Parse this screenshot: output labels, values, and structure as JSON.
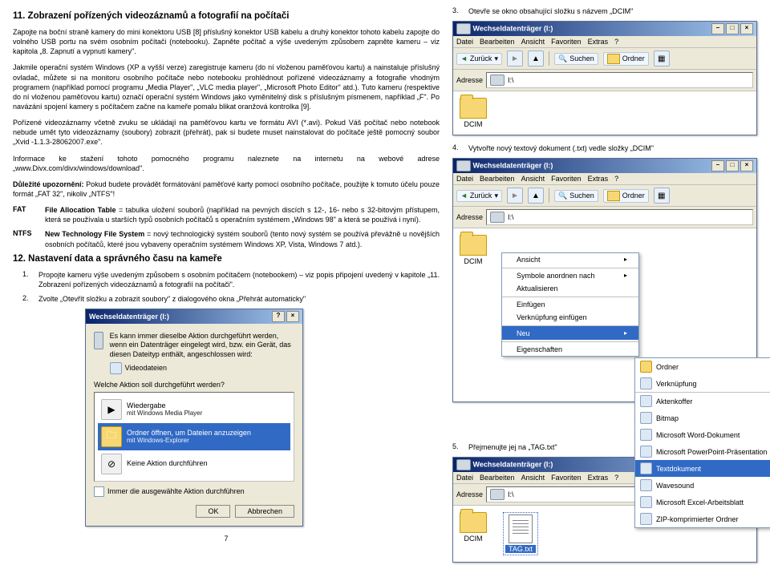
{
  "section11": {
    "title": "11. Zobrazení pořízených videozáznamů a fotografií na počítači",
    "p1": "Zapojte na boční straně kamery do mini konektoru USB [8] příslušný konektor USB kabelu a druhý konektor tohoto kabelu zapojte do volného USB portu na svém osobním počítači (notebooku). Zapněte počítač a výše uvedeným způsobem zapněte kameru – viz kapitola „8. Zapnutí a vypnutí kamery\".",
    "p2": "Jakmile operační systém Windows (XP a vyšší verze) zaregistruje kameru (do ní vloženou paměťovou kartu) a nainstaluje příslušný ovladač, můžete si na monitoru osobního počítače nebo notebooku prohlédnout pořízené videozáznamy a fotografie vhodným programem (například pomocí programu „Media Player\", „VLC media player\", „Microsoft Photo Editor\" atd.). Tuto kameru (respektive do ní vloženou paměťovou kartu) označí operační systém Windows jako vyměnitelný disk s příslušným písmenem, například „F\". Po navázání spojení kamery s počítačem začne na kameře pomalu blikat oranžová kontrolka [9].",
    "p3": "Pořízené videozáznamy včetně zvuku se ukládají na paměťovou kartu ve formátu AVI (*.avi). Pokud Váš počítač nebo notebook nebude umět tyto videozáznamy (soubory) zobrazit (přehrát), pak si budete muset nainstalovat do počítače ještě pomocný soubor „Xvid -1.1.3-28062007.exe\".",
    "p4": "Informace ke stažení tohoto pomocného programu naleznete na internetu na webové adrese „www.Divx.com/divx/windows/download\".",
    "p5_prefix": "Důležité upozornění:",
    "p5": " Pokud budete provádět formátování paměťové karty pomocí osobního počítače, použijte k tomuto účelu pouze formát „FAT 32\", nikoliv „NTFS\"!",
    "def_fat_term": "FAT",
    "def_fat": "File Allocation Table = tabulka uložení souborů (například na pevných discích s 12-, 16- nebo s 32-bitovým přístupem, která se používala u starších typů osobních počítačů s operačním systémem „Windows 98\" a která se používá i nyní).",
    "def_ntfs_term": "NTFS",
    "def_ntfs": "New Technology File System = nový technologický systém souborů (tento nový systém se používá převážně u novějších osobních počítačů, které jsou vybaveny operačním systémem Windows XP, Vista, Windows 7 atd.)."
  },
  "section12": {
    "title": "12. Nastavení data a správného času na kameře",
    "step1_num": "1.",
    "step1": "Propojte kameru výše uvedeným způsobem s osobním počítačem (notebookem) – viz popis připojení uvedený v kapitole „11. Zobrazení pořízených videozáznamů a fotografií na počítači\".",
    "step2_num": "2.",
    "step2": "Zvolte „Otevřít složku a zobrazit soubory\" z dialogového okna „Přehrát automaticky\""
  },
  "autoplay": {
    "title": "Wechseldatenträger (I:)",
    "intro": "Es kann immer dieselbe Aktion durchgeführt werden, wenn ein Datenträger eingelegt wird, bzw. ein Gerät, das diesen Dateityp enthält, angeschlossen wird:",
    "filetype": "Videodateien",
    "question": "Welche Aktion soll durchgeführt werden?",
    "opt1_title": "Wiedergabe",
    "opt1_sub": "mit Windows Media Player",
    "opt2_title": "Ordner öffnen, um Dateien anzuzeigen",
    "opt2_sub": "mit Windows-Explorer",
    "opt3_title": "Keine Aktion durchführen",
    "checkbox": "Immer die ausgewählte Aktion durchführen",
    "ok": "OK",
    "cancel": "Abbrechen"
  },
  "right": {
    "step3_num": "3.",
    "step3": "Otevře se okno obsahující složku s názvem „DCIM\"",
    "step4_num": "4.",
    "step4": "Vytvořte nový textový dokument (.txt) vedle složky „DCIM\"",
    "step5_num": "5.",
    "step5": "Přejmenujte jej na „TAG.txt\""
  },
  "explorer": {
    "title": "Wechseldatenträger (I:)",
    "menu_datei": "Datei",
    "menu_bearb": "Bearbeiten",
    "menu_ansicht": "Ansicht",
    "menu_fav": "Favoriten",
    "menu_extras": "Extras",
    "menu_help": "?",
    "tb_back": "Zurück",
    "tb_search": "Suchen",
    "tb_folders": "Ordner",
    "addr_label": "Adresse",
    "addr_value": "I:\\",
    "folder_dcim": "DCIM"
  },
  "ctx": {
    "ansicht": "Ansicht",
    "symbole": "Symbole anordnen nach",
    "aktual": "Aktualisieren",
    "einfugen": "Einfügen",
    "verkn": "Verknüpfung einfügen",
    "neu": "Neu",
    "eigen": "Eigenschaften"
  },
  "submenu": {
    "ordner": "Ordner",
    "verkn": "Verknüpfung",
    "akten": "Aktenkoffer",
    "bitmap": "Bitmap",
    "word": "Microsoft Word-Dokument",
    "ppt": "Microsoft PowerPoint-Präsentation",
    "txt": "Textdokument",
    "wave": "Wavesound",
    "excel": "Microsoft Excel-Arbeitsblatt",
    "zip": "ZIP-komprimierter Ordner"
  },
  "tag_file": "TAG.txt",
  "page_num": "7"
}
